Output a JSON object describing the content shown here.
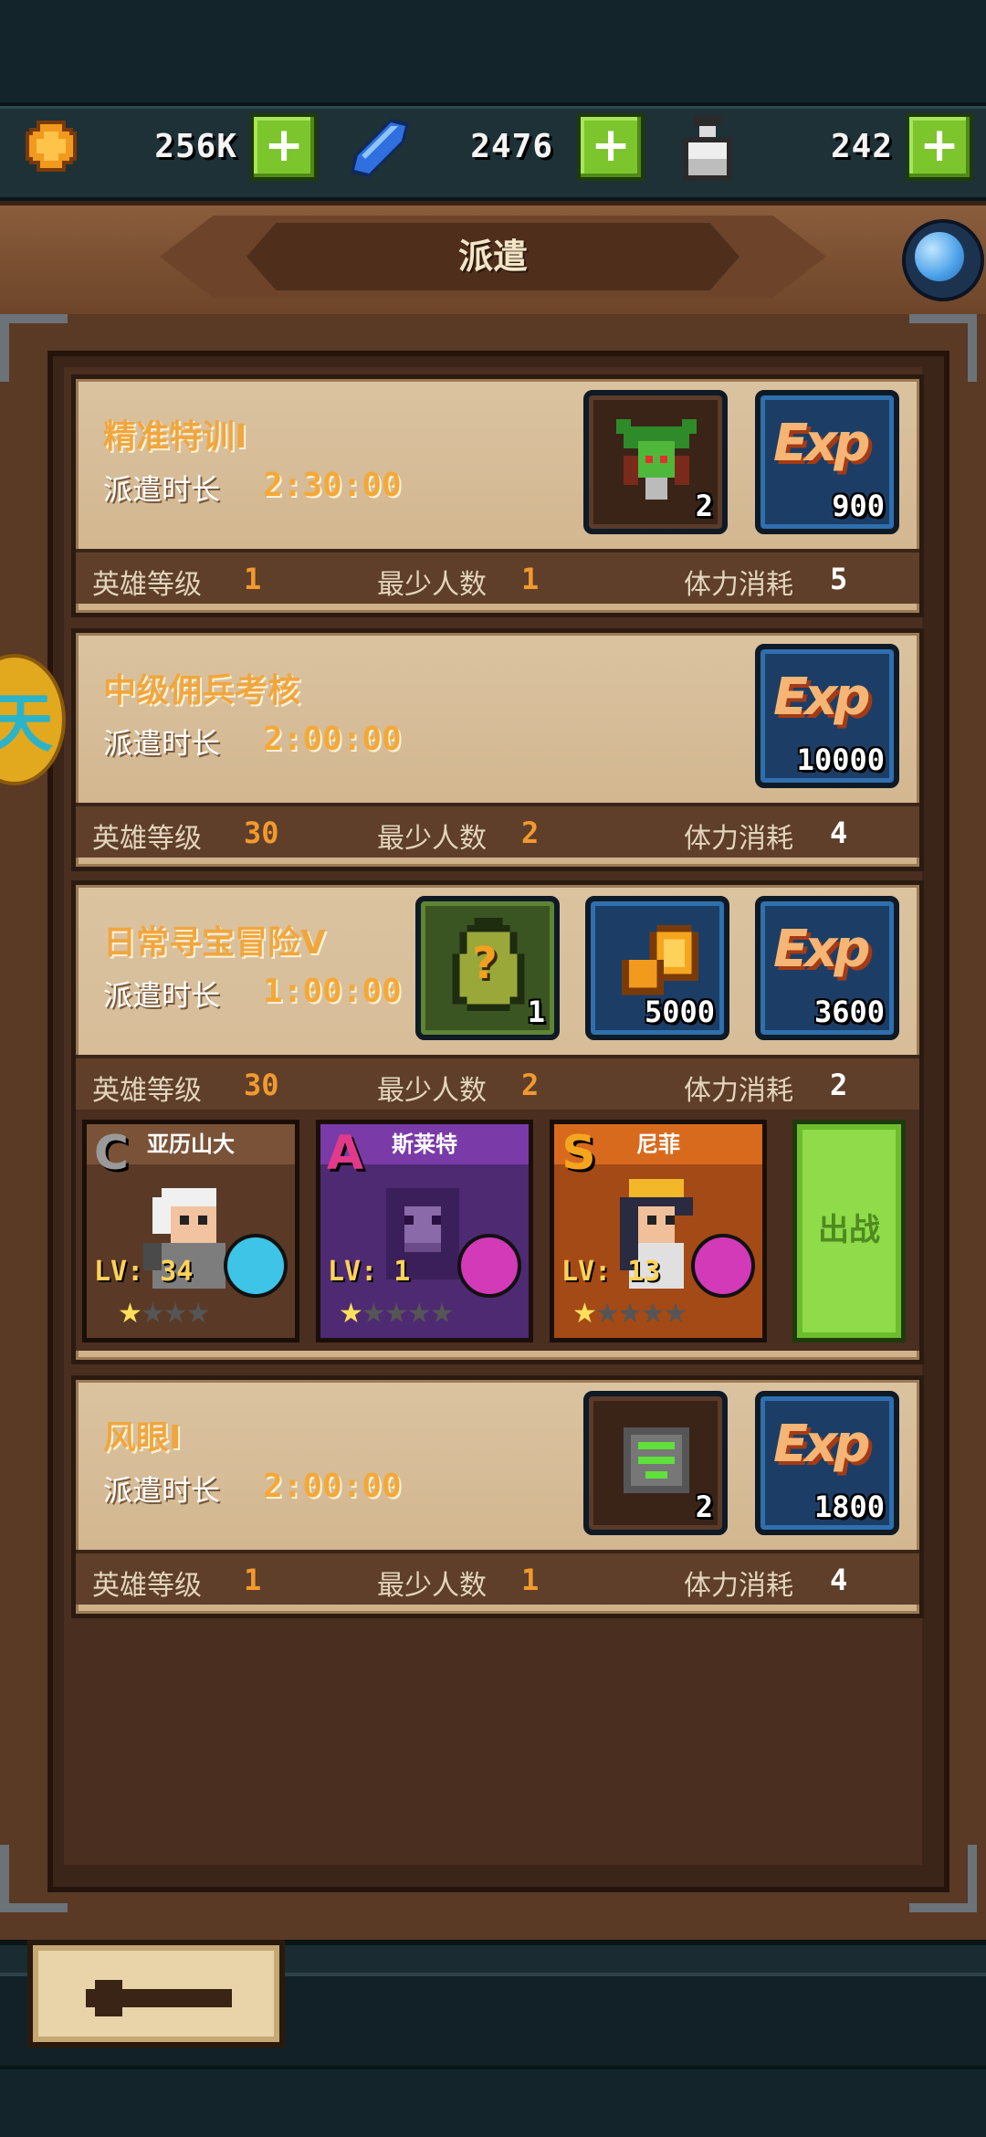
{
  "currencies": [
    {
      "name": "gold",
      "value": "256K",
      "icon": "gold-coin-icon"
    },
    {
      "name": "gem",
      "value": "2476",
      "icon": "blue-crystal-icon"
    },
    {
      "name": "stamina",
      "value": "242",
      "icon": "potion-bottle-icon"
    }
  ],
  "header": {
    "title": "派遣"
  },
  "missions": [
    {
      "title": "精准特训I",
      "duration_label": "派遣时长",
      "duration": "2:30:00",
      "hero_level_label": "英雄等级",
      "hero_level": "1",
      "min_people_label": "最少人数",
      "min_people": "1",
      "stamina_label": "体力消耗",
      "stamina": "5",
      "rewards": [
        {
          "type": "creature",
          "icon": "green-spider-icon",
          "qty": "2"
        },
        {
          "type": "exp",
          "label": "Exp",
          "qty": "900"
        }
      ]
    },
    {
      "title": "中级佣兵考核",
      "duration_label": "派遣时长",
      "duration": "2:00:00",
      "hero_level_label": "英雄等级",
      "hero_level": "30",
      "min_people_label": "最少人数",
      "min_people": "2",
      "stamina_label": "体力消耗",
      "stamina": "4",
      "rewards": [
        {
          "type": "exp",
          "label": "Exp",
          "qty": "10000"
        }
      ]
    },
    {
      "title": "日常寻宝冒险V",
      "duration_label": "派遣时长",
      "duration": "1:00:00",
      "hero_level_label": "英雄等级",
      "hero_level": "30",
      "min_people_label": "最少人数",
      "min_people": "2",
      "stamina_label": "体力消耗",
      "stamina": "2",
      "rewards": [
        {
          "type": "mystery",
          "icon": "mystery-egg-icon",
          "label": "?",
          "qty": "1"
        },
        {
          "type": "gold",
          "icon": "gold-coins-icon",
          "qty": "5000"
        },
        {
          "type": "exp",
          "label": "Exp",
          "qty": "3600"
        }
      ],
      "heroes": [
        {
          "name": "亚历山大",
          "rank": "C",
          "level": "LV: 34",
          "stars": 1,
          "max_stars": 4,
          "color": "#8a5a3c",
          "weapon": "#3ec4e6"
        },
        {
          "name": "斯莱特",
          "rank": "A",
          "level": "LV: 1",
          "stars": 1,
          "max_stars": 5,
          "color": "#7a3aa8",
          "weapon": "#d23ab8"
        },
        {
          "name": "尼菲",
          "rank": "S",
          "level": "LV: 13",
          "stars": 1,
          "max_stars": 5,
          "color": "#d86a1e",
          "weapon": "#d23ab8"
        }
      ],
      "deploy_button": "出战"
    },
    {
      "title": "风眼I",
      "duration_label": "派遣时长",
      "duration": "2:00:00",
      "hero_level_label": "英雄等级",
      "hero_level": "1",
      "min_people_label": "最少人数",
      "min_people": "1",
      "stamina_label": "体力消耗",
      "stamina": "4",
      "rewards": [
        {
          "type": "item",
          "icon": "tornado-icon",
          "qty": "2"
        },
        {
          "type": "exp",
          "label": "Exp",
          "qty": "1800"
        }
      ]
    }
  ],
  "side_medal": {
    "text": "天"
  },
  "colors": {
    "accent_orange": "#f29a2e",
    "exp_blue": "#1c3e66",
    "go_green": "#8fdb4a"
  }
}
